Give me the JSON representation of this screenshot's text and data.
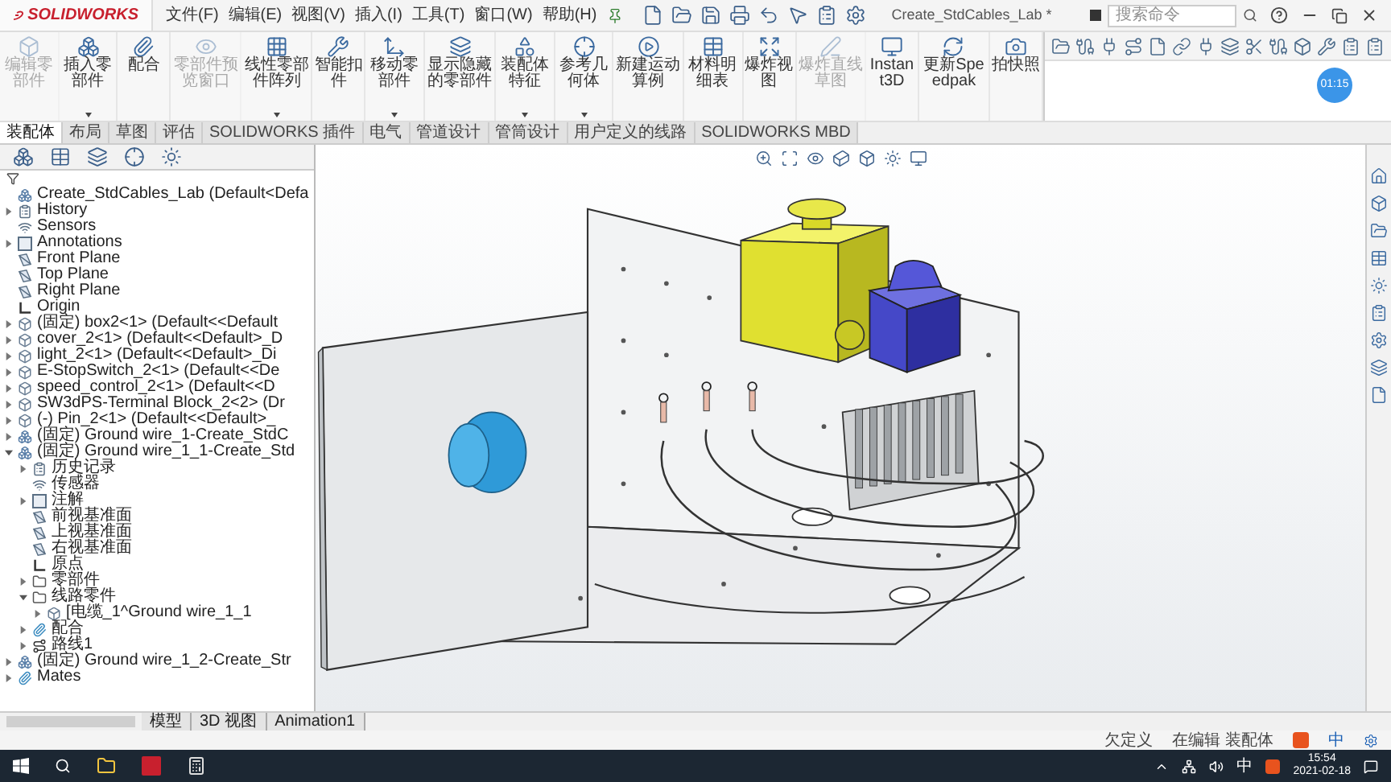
{
  "window": {
    "app": "SOLIDWORKS",
    "title": "Create_StdCables_Lab *"
  },
  "menu": [
    {
      "label": "文件(F)"
    },
    {
      "label": "编辑(E)"
    },
    {
      "label": "视图(V)"
    },
    {
      "label": "插入(I)"
    },
    {
      "label": "工具(T)"
    },
    {
      "label": "窗口(W)"
    },
    {
      "label": "帮助(H)"
    }
  ],
  "search": {
    "placeholder": "搜索命令"
  },
  "timer_badge": "01:15",
  "ribbon": [
    {
      "label": "编辑零部件",
      "disabled": true,
      "dropdown": false
    },
    {
      "label": "插入零部件",
      "disabled": false,
      "dropdown": true
    },
    {
      "label": "配合",
      "disabled": false,
      "dropdown": false
    },
    {
      "label": "零部件预览窗口",
      "disabled": true,
      "dropdown": false
    },
    {
      "label": "线性零部件阵列",
      "disabled": false,
      "dropdown": true
    },
    {
      "label": "智能扣件",
      "disabled": false,
      "dropdown": false
    },
    {
      "label": "移动零部件",
      "disabled": false,
      "dropdown": true
    },
    {
      "label": "显示隐藏的零部件",
      "disabled": false,
      "dropdown": false
    },
    {
      "label": "装配体特征",
      "disabled": false,
      "dropdown": true
    },
    {
      "label": "参考几何体",
      "disabled": false,
      "dropdown": true
    },
    {
      "label": "新建运动算例",
      "disabled": false,
      "dropdown": false
    },
    {
      "label": "材料明细表",
      "disabled": false,
      "dropdown": false
    },
    {
      "label": "爆炸视图",
      "disabled": false,
      "dropdown": false
    },
    {
      "label": "爆炸直线草图",
      "disabled": true,
      "dropdown": false
    },
    {
      "label": "Instant3D",
      "disabled": false,
      "dropdown": false
    },
    {
      "label": "更新Speedpak",
      "disabled": false,
      "dropdown": false
    },
    {
      "label": "拍快照",
      "disabled": false,
      "dropdown": false
    }
  ],
  "ribbon_tabs": [
    {
      "label": "装配体",
      "selected": true
    },
    {
      "label": "布局",
      "selected": false
    },
    {
      "label": "草图",
      "selected": false
    },
    {
      "label": "评估",
      "selected": false
    },
    {
      "label": "SOLIDWORKS 插件",
      "selected": false
    },
    {
      "label": "电气",
      "selected": false
    },
    {
      "label": "管道设计",
      "selected": false
    },
    {
      "label": "管筒设计",
      "selected": false
    },
    {
      "label": "用户定义的线路",
      "selected": false
    },
    {
      "label": "SOLIDWORKS MBD",
      "selected": false
    }
  ],
  "feature_tree": [
    {
      "label": "Create_StdCables_Lab  (Default<Defa",
      "kind": "assembly",
      "children": [
        {
          "label": "History",
          "kind": "history",
          "expanded": false
        },
        {
          "label": "Sensors",
          "kind": "sensor"
        },
        {
          "label": "Annotations",
          "kind": "annotation",
          "expanded": false
        },
        {
          "label": "Front Plane",
          "kind": "plane"
        },
        {
          "label": "Top Plane",
          "kind": "plane"
        },
        {
          "label": "Right Plane",
          "kind": "plane"
        },
        {
          "label": "Origin",
          "kind": "origin"
        },
        {
          "label": "(固定) box2<1> (Default<<Default",
          "kind": "part",
          "expanded": false
        },
        {
          "label": "cover_2<1> (Default<<Default>_D",
          "kind": "part",
          "expanded": false
        },
        {
          "label": "light_2<1> (Default<<Default>_Di",
          "kind": "part",
          "expanded": false
        },
        {
          "label": "E-StopSwitch_2<1> (Default<<De",
          "kind": "part",
          "expanded": false
        },
        {
          "label": "speed_control_2<1> (Default<<D",
          "kind": "part",
          "expanded": false
        },
        {
          "label": "SW3dPS-Terminal Block_2<2> (Dr",
          "kind": "part",
          "expanded": false
        },
        {
          "label": "(-) Pin_2<1> (Default<<Default>_",
          "kind": "part",
          "expanded": false
        },
        {
          "label": "(固定) Ground wire_1-Create_StdC",
          "kind": "subassembly",
          "expanded": false
        },
        {
          "label": "(固定) Ground wire_1_1-Create_Std",
          "kind": "subassembly",
          "expanded": true,
          "children": [
            {
              "label": "历史记录",
              "kind": "history",
              "expanded": false
            },
            {
              "label": "传感器",
              "kind": "sensor"
            },
            {
              "label": "注解",
              "kind": "annotation",
              "expanded": false
            },
            {
              "label": "前视基准面",
              "kind": "plane"
            },
            {
              "label": "上视基准面",
              "kind": "plane"
            },
            {
              "label": "右视基准面",
              "kind": "plane"
            },
            {
              "label": "原点",
              "kind": "origin"
            },
            {
              "label": "零部件",
              "kind": "folder",
              "expanded": false
            },
            {
              "label": "线路零件",
              "kind": "folder",
              "expanded": true,
              "children": [
                {
                  "label": "[电缆_1^Ground wire_1_1",
                  "kind": "part",
                  "expanded": false
                }
              ]
            },
            {
              "label": "配合",
              "kind": "mates",
              "expanded": false
            },
            {
              "label": "路线1",
              "kind": "route",
              "expanded": false
            }
          ]
        },
        {
          "label": "(固定) Ground wire_1_2-Create_Str",
          "kind": "subassembly",
          "expanded": false
        },
        {
          "label": "Mates",
          "kind": "mates",
          "expanded": false
        }
      ]
    }
  ],
  "bottom_tabs": [
    {
      "label": "模型",
      "selected": false
    },
    {
      "label": "3D 视图",
      "selected": false
    },
    {
      "label": "Animation1",
      "selected": false
    }
  ],
  "status_bar": [
    {
      "label": "欠定义"
    },
    {
      "label": "在编辑 装配体"
    }
  ],
  "taskbar": {
    "ime": "中",
    "status_ime": "中",
    "time": "15:54",
    "date": "2021-02-18"
  }
}
